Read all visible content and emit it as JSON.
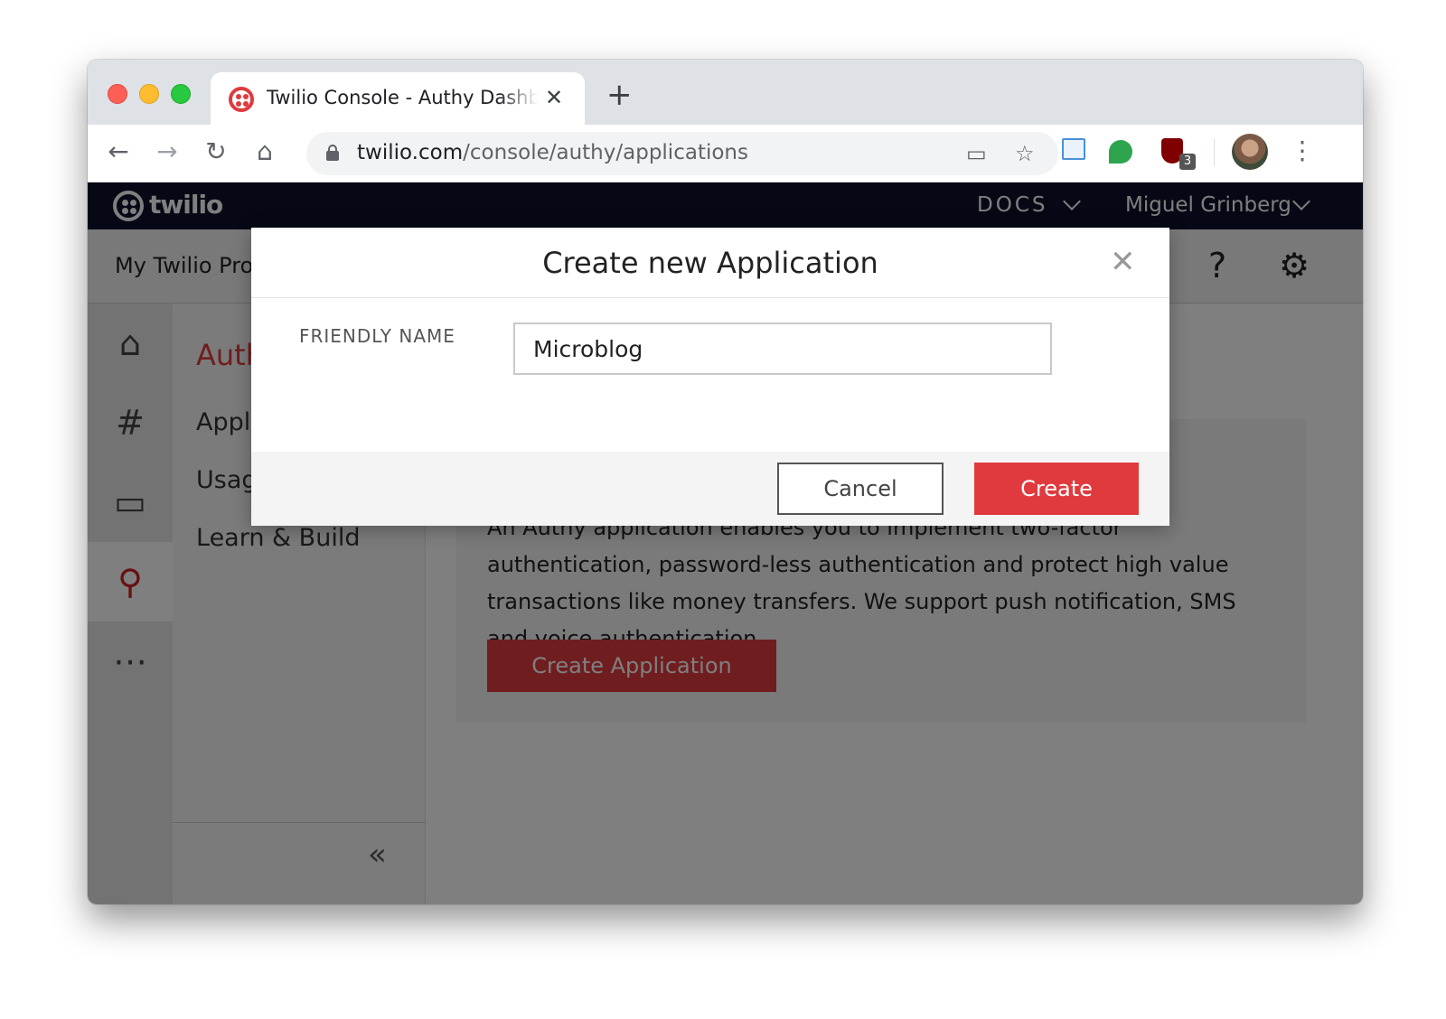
{
  "browser": {
    "tab_title": "Twilio Console - Authy Dashboard",
    "tab_close": "✕",
    "new_tab": "+",
    "url_host": "twilio.com",
    "url_path": "/console/authy/applications",
    "extension_badge": "3",
    "icons": [
      "back-icon",
      "forward-icon",
      "reload-icon",
      "home-icon",
      "lock-icon",
      "cast-icon",
      "star-icon",
      "kebab-icon"
    ]
  },
  "twilio": {
    "logo_text": "twilio",
    "docs_label": "DOCS",
    "user_name": "Miguel Grinberg",
    "project_name": "My Twilio Pro",
    "help_glyph": "?",
    "sidebar": {
      "heading": "Auth",
      "items": [
        "Appl",
        "Usag",
        "Learn & Build"
      ],
      "collapse_glyph": "«"
    },
    "card": {
      "description": "An Authy application enables you to implement two-factor authentication, password-less authentication and protect high value transactions like money transfers. We support push notification, SMS and voice authentication.",
      "create_button": "Create Application"
    }
  },
  "modal": {
    "title": "Create new Application",
    "close_glyph": "✕",
    "field_label": "FRIENDLY NAME",
    "field_value": "Microblog",
    "cancel_label": "Cancel",
    "create_label": "Create"
  },
  "colors": {
    "twilio_red": "#e03a3e",
    "topbar_navy": "#0d122b"
  }
}
